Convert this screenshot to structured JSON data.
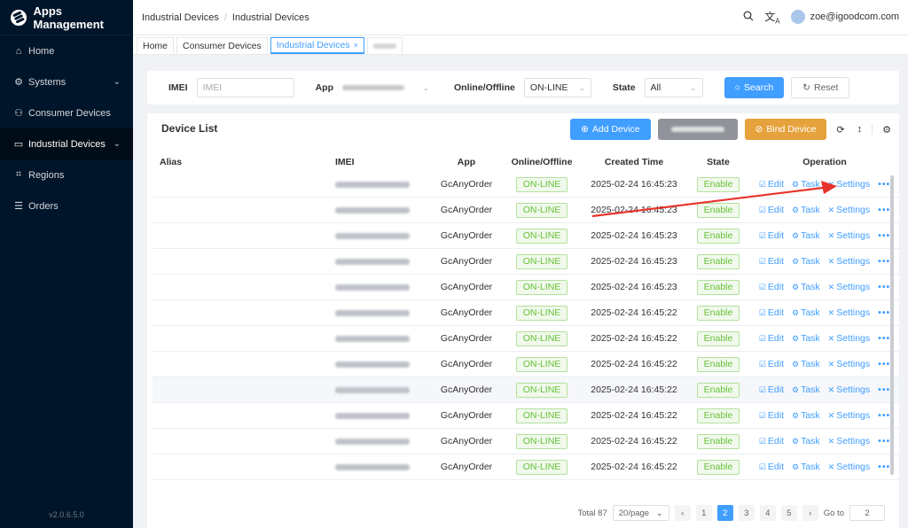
{
  "sidebar": {
    "brand": "Apps Management",
    "items": [
      {
        "label": "Home",
        "icon": "home-icon",
        "glyph": "⌂"
      },
      {
        "label": "Systems",
        "icon": "gear-icon",
        "glyph": "⚙",
        "chevron": "⌄"
      },
      {
        "label": "Consumer Devices",
        "icon": "users-icon",
        "glyph": "⚇"
      },
      {
        "label": "Industrial Devices",
        "icon": "monitor-icon",
        "glyph": "▭",
        "chevron": "⌄"
      },
      {
        "label": "Regions",
        "icon": "frame-icon",
        "glyph": "⌗"
      },
      {
        "label": "Orders",
        "icon": "list-icon",
        "glyph": "☰"
      }
    ],
    "version": "v2.0.6.5.0"
  },
  "header": {
    "breadcrumb": [
      "Industrial Devices",
      "Industrial Devices"
    ],
    "user": "zoe@igoodcom.com"
  },
  "tabs": [
    {
      "label": "Home"
    },
    {
      "label": "Consumer Devices"
    },
    {
      "label": "Industrial Devices",
      "close": "×"
    }
  ],
  "filter": {
    "imei_label": "IMEI",
    "imei_placeholder": "IMEI",
    "app_label": "App",
    "online_label": "Online/Offline",
    "online_value": "ON-LINE",
    "state_label": "State",
    "state_value": "All",
    "search_label": "Search",
    "reset_label": "Reset"
  },
  "table": {
    "title": "Device List",
    "add_label": "Add Device",
    "bind_label": "Bind Device",
    "headers": {
      "alias": "Alias",
      "imei": "IMEI",
      "app": "App",
      "online": "Online/Offline",
      "created": "Created Time",
      "state": "State",
      "operation": "Operation"
    },
    "rows": [
      {
        "app": "GcAnyOrder",
        "online": "ON-LINE",
        "created": "2025-02-24 16:45:23",
        "state": "Enable"
      },
      {
        "app": "GcAnyOrder",
        "online": "ON-LINE",
        "created": "2025-02-24 16:45:23",
        "state": "Enable"
      },
      {
        "app": "GcAnyOrder",
        "online": "ON-LINE",
        "created": "2025-02-24 16:45:23",
        "state": "Enable"
      },
      {
        "app": "GcAnyOrder",
        "online": "ON-LINE",
        "created": "2025-02-24 16:45:23",
        "state": "Enable"
      },
      {
        "app": "GcAnyOrder",
        "online": "ON-LINE",
        "created": "2025-02-24 16:45:23",
        "state": "Enable"
      },
      {
        "app": "GcAnyOrder",
        "online": "ON-LINE",
        "created": "2025-02-24 16:45:22",
        "state": "Enable"
      },
      {
        "app": "GcAnyOrder",
        "online": "ON-LINE",
        "created": "2025-02-24 16:45:22",
        "state": "Enable"
      },
      {
        "app": "GcAnyOrder",
        "online": "ON-LINE",
        "created": "2025-02-24 16:45:22",
        "state": "Enable"
      },
      {
        "app": "GcAnyOrder",
        "online": "ON-LINE",
        "created": "2025-02-24 16:45:22",
        "state": "Enable"
      },
      {
        "app": "GcAnyOrder",
        "online": "ON-LINE",
        "created": "2025-02-24 16:45:22",
        "state": "Enable"
      },
      {
        "app": "GcAnyOrder",
        "online": "ON-LINE",
        "created": "2025-02-24 16:45:22",
        "state": "Enable"
      },
      {
        "app": "GcAnyOrder",
        "online": "ON-LINE",
        "created": "2025-02-24 16:45:22",
        "state": "Enable"
      }
    ],
    "ops": {
      "edit": "Edit",
      "task": "Task",
      "settings": "Settings",
      "more": "•••"
    }
  },
  "pagination": {
    "total": "Total 87",
    "page_size": "20/page",
    "pages": [
      "1",
      "2",
      "3",
      "4",
      "5"
    ],
    "current": "2",
    "goto_label": "Go to",
    "goto_value": "2"
  },
  "colors": {
    "sidebar": "#001529",
    "primary": "#409eff",
    "warning": "#e6a23c",
    "success": "#67c23a",
    "annotation": "#e8332a"
  }
}
